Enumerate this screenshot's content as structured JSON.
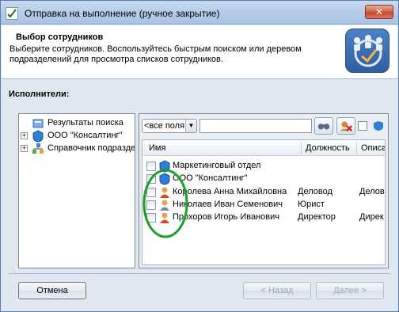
{
  "window": {
    "title": "Отправка на выполнение (ручное закрытие)",
    "close_glyph": "✕"
  },
  "header": {
    "title": "Выбор сотрудников",
    "description": "Выберите сотрудников. Воспользуйтесь быстрым поиском или деревом подразделений для просмотра списков сотрудников."
  },
  "section": {
    "label": "Исполнители:"
  },
  "tree": {
    "items": [
      {
        "label": "Результаты поиска",
        "icon": "search-results-icon",
        "expander": ""
      },
      {
        "label": "ООО \"Консалтинг\"",
        "icon": "organization-icon",
        "expander": "+"
      },
      {
        "label": "Справочник подразде",
        "icon": "department-directory-icon",
        "expander": "+"
      }
    ]
  },
  "toolbar": {
    "filter_value": "<все поля",
    "search_value": ""
  },
  "grid": {
    "columns": [
      "Имя",
      "Должность",
      "Описа"
    ],
    "rows": [
      {
        "name": "Маркетинговый отдел",
        "position": "",
        "description": "",
        "icon": "department-icon"
      },
      {
        "name": "ООО \"Консалтинг\"",
        "position": "",
        "description": "",
        "icon": "organization-icon"
      },
      {
        "name": "Королева Анна Михайловна",
        "position": "Деловод",
        "description": "Делов",
        "icon": "user-icon"
      },
      {
        "name": "Николаев Иван Семенович",
        "position": "Юрист",
        "description": "",
        "icon": "user-icon"
      },
      {
        "name": "Прохоров Игорь Иванович",
        "position": "Директор",
        "description": "Дирек",
        "icon": "user-icon"
      }
    ]
  },
  "buttons": {
    "cancel": "Отмена",
    "back": "< Назад",
    "next": "Далее >"
  },
  "colors": {
    "annotation": "#1aa02a",
    "titlebar": "#b6cde9",
    "accent": "#2f5f9f"
  }
}
